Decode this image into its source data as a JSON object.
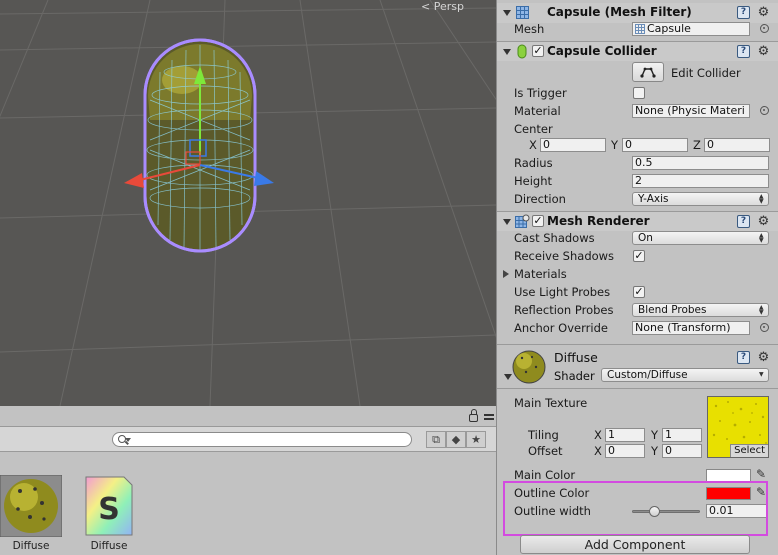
{
  "scene": {
    "view_label": "Persp"
  },
  "project": {
    "assets": [
      {
        "label": "Diffuse",
        "kind": "material-sphere"
      },
      {
        "label": "Diffuse",
        "kind": "shader-file",
        "glyph": "S"
      }
    ]
  },
  "inspector": {
    "mesh_filter": {
      "title": "Capsule (Mesh Filter)",
      "mesh_label": "Mesh",
      "mesh_value": "Capsule"
    },
    "capsule_collider": {
      "title": "Capsule Collider",
      "enabled": true,
      "edit_collider_label": "Edit Collider",
      "is_trigger_label": "Is Trigger",
      "is_trigger": false,
      "material_label": "Material",
      "material_value": "None (Physic Materi",
      "center_label": "Center",
      "center": {
        "x_label": "X",
        "x": "0",
        "y_label": "Y",
        "y": "0",
        "z_label": "Z",
        "z": "0"
      },
      "radius_label": "Radius",
      "radius": "0.5",
      "height_label": "Height",
      "height": "2",
      "direction_label": "Direction",
      "direction": "Y-Axis"
    },
    "mesh_renderer": {
      "title": "Mesh Renderer",
      "enabled": true,
      "cast_shadows_label": "Cast Shadows",
      "cast_shadows": "On",
      "receive_shadows_label": "Receive Shadows",
      "receive_shadows": true,
      "materials_label": "Materials",
      "use_light_probes_label": "Use Light Probes",
      "use_light_probes": true,
      "reflection_probes_label": "Reflection Probes",
      "reflection_probes": "Blend Probes",
      "anchor_override_label": "Anchor Override",
      "anchor_override": "None (Transform)"
    },
    "material": {
      "name": "Diffuse",
      "shader_label": "Shader",
      "shader": "Custom/Diffuse",
      "main_texture_label": "Main Texture",
      "texture_select_label": "Select",
      "tiling_label": "Tiling",
      "tiling": {
        "x_label": "X",
        "x": "1",
        "y_label": "Y",
        "y": "1"
      },
      "offset_label": "Offset",
      "offset": {
        "x_label": "X",
        "x": "0",
        "y_label": "Y",
        "y": "0"
      },
      "main_color_label": "Main Color",
      "main_color": "#ffffff",
      "outline_color_label": "Outline Color",
      "outline_color": "#ff0000",
      "outline_width_label": "Outline width",
      "outline_width": "0.01",
      "outline_width_fraction": 0.33
    },
    "add_component_label": "Add Component"
  },
  "colors": {
    "scene_bg": "#575654",
    "highlight": "#d34be0",
    "wire": "#7fd8ff",
    "selection": "#a98cff"
  }
}
